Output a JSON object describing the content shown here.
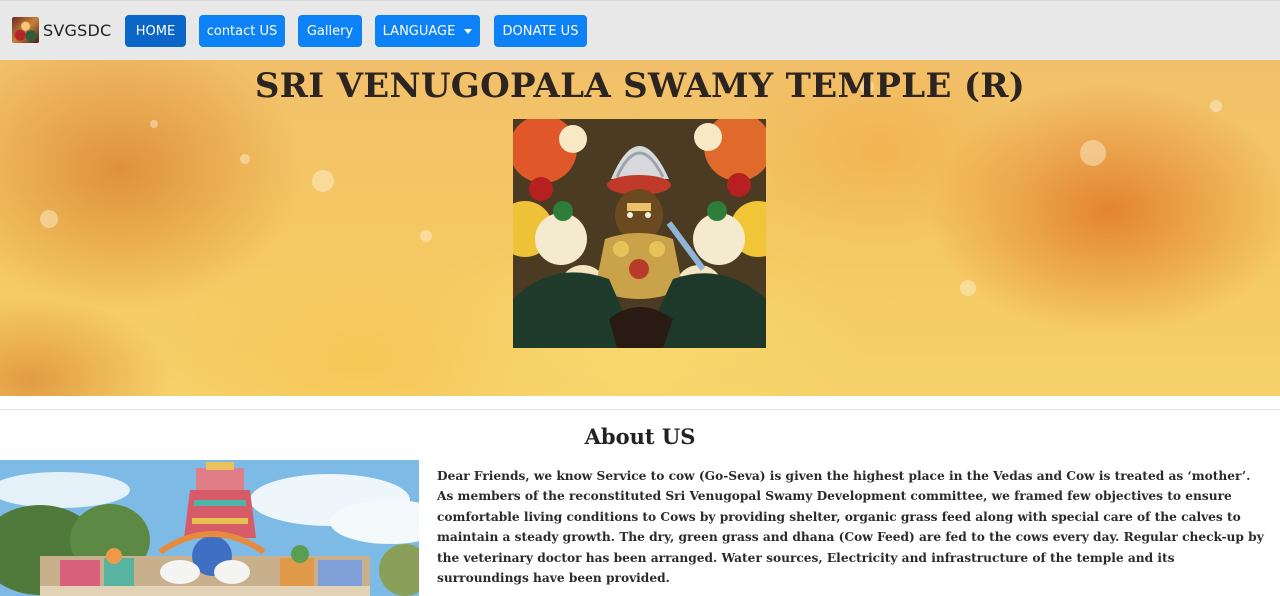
{
  "navbar": {
    "brand": "SVGSDC",
    "links": {
      "home": "HOME",
      "contact": "contact US",
      "gallery": "Gallery",
      "language": "LANGUAGE",
      "donate": "DONATE US"
    }
  },
  "hero": {
    "title": "SRI VENUGOPALA SWAMY TEMPLE (R)"
  },
  "about": {
    "title": "About US",
    "text": "Dear Friends, we know Service to cow (Go-Seva) is given the highest place in the Vedas and Cow is treated as ‘mother’. As members of the reconstituted Sri Venugopal Swamy Development committee, we framed few objectives to ensure comfortable living conditions to Cows by providing shelter, organic grass feed along with special care of the calves to maintain a steady growth. The dry, green grass and dhana (Cow Feed) are fed to the cows every day. Regular check-up by the veterinary doctor has been arranged. Water sources, Electricity and infrastructure of the temple and its surroundings have been provided."
  },
  "colors": {
    "nav_button": "#0d82f7",
    "nav_button_active": "#0a66c8",
    "navbar_bg": "#e8e8e8",
    "hero_warm": "#f4c862"
  },
  "icons": {
    "language_dropdown": "caret-down-icon"
  }
}
